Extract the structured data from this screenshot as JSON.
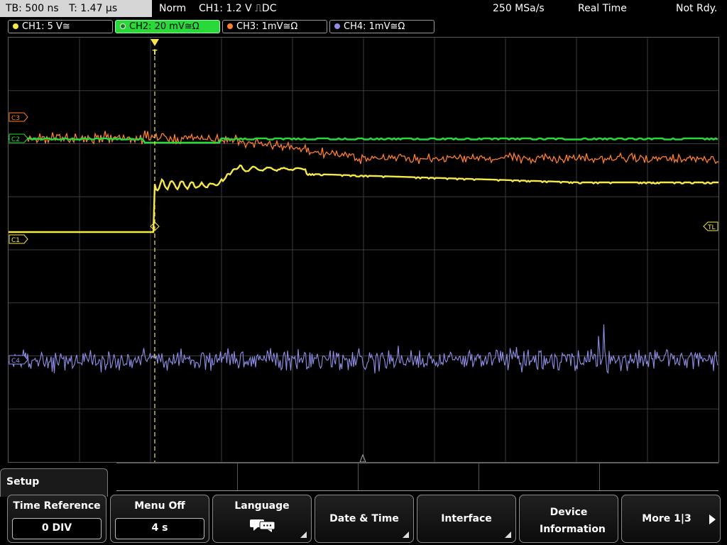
{
  "topbar": {
    "timebase": "TB: 500 ns",
    "trigger_time": "T: 1.47 µs",
    "mode": "Norm",
    "trigger": "CH1: 1.2 V ⎍DC",
    "sample_rate": "250 MSa/s",
    "acq_mode": "Real Time",
    "status": "Not Rdy."
  },
  "channels": [
    {
      "label": "CH1: 5 V≅",
      "color": "#f5e84a",
      "active": false
    },
    {
      "label": "CH2: 20 mV≅Ω",
      "color": "#29d93a",
      "active": true
    },
    {
      "label": "CH3: 1mV≅Ω",
      "color": "#ff7f2a",
      "active": false
    },
    {
      "label": "CH4: 1mV≅Ω",
      "color": "#8f8fe8",
      "active": false
    }
  ],
  "markers": {
    "c3": "C3",
    "c2": "C2",
    "c1": "C1",
    "c4": "C4",
    "trigger_level": "TL",
    "trigger_pos": "T"
  },
  "menu": {
    "title": "Setup",
    "keys": [
      {
        "label": "Time Reference",
        "value": "0 DIV"
      },
      {
        "label": "Menu Off",
        "value": "4 s"
      },
      {
        "label": "Language",
        "icon": "speech-bubbles-icon"
      },
      {
        "label": "Date & Time"
      },
      {
        "label": "Interface"
      },
      {
        "label": "Device Information"
      },
      {
        "label": "More 1|3"
      }
    ]
  },
  "colors": {
    "ch1": "#f5e84a",
    "ch2": "#29d93a",
    "ch3": "#ff7f2a",
    "ch4": "#8f8fe8",
    "grid": "#3c3c3c"
  }
}
